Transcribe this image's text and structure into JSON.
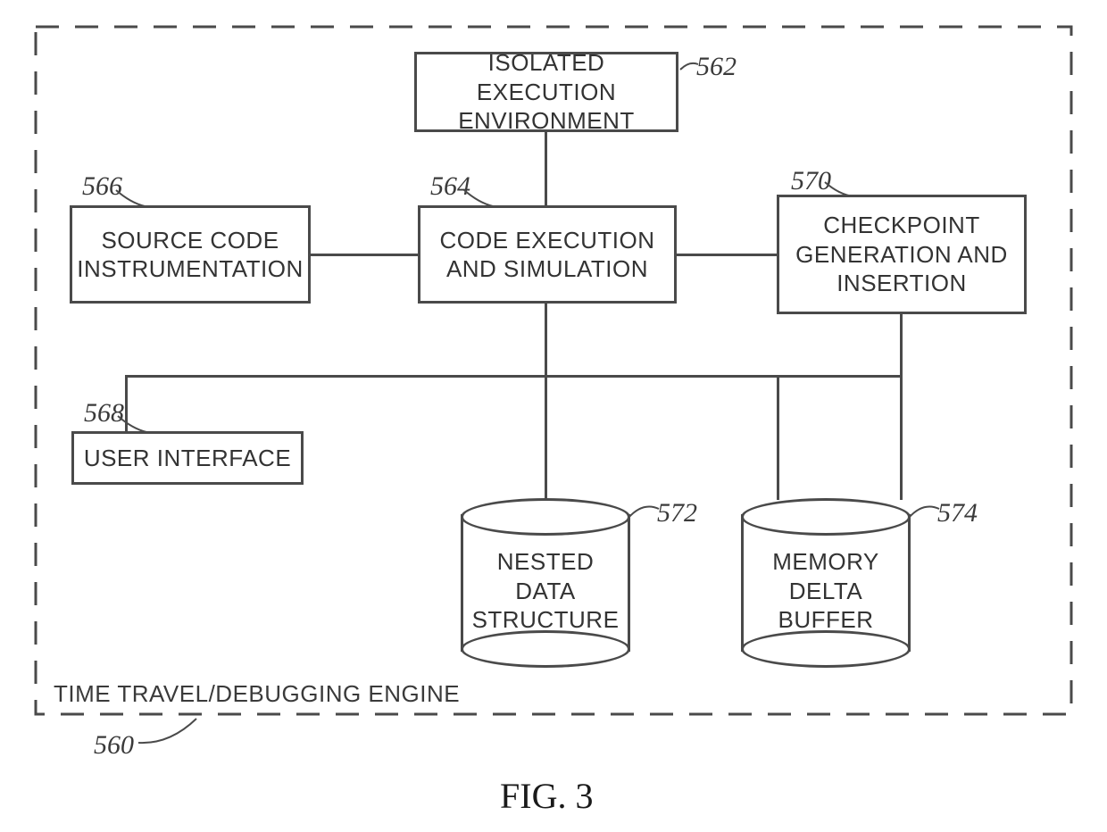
{
  "figure_label": "FIG. 3",
  "container": {
    "label": "TIME TRAVEL/DEBUGGING ENGINE",
    "ref": "560"
  },
  "boxes": {
    "isolated_env": {
      "label": "ISOLATED EXECUTION\nENVIRONMENT",
      "ref": "562"
    },
    "source_instr": {
      "label": "SOURCE CODE\nINSTRUMENTATION",
      "ref": "566"
    },
    "code_exec": {
      "label": "CODE EXECUTION\nAND SIMULATION",
      "ref": "564"
    },
    "checkpoint": {
      "label": "CHECKPOINT\nGENERATION AND\nINSERTION",
      "ref": "570"
    },
    "user_iface": {
      "label": "USER INTERFACE",
      "ref": "568"
    }
  },
  "cylinders": {
    "nested": {
      "label": "NESTED\nDATA\nSTRUCTURE",
      "ref": "572"
    },
    "mem_delta": {
      "label": "MEMORY\nDELTA\nBUFFER",
      "ref": "574"
    }
  }
}
